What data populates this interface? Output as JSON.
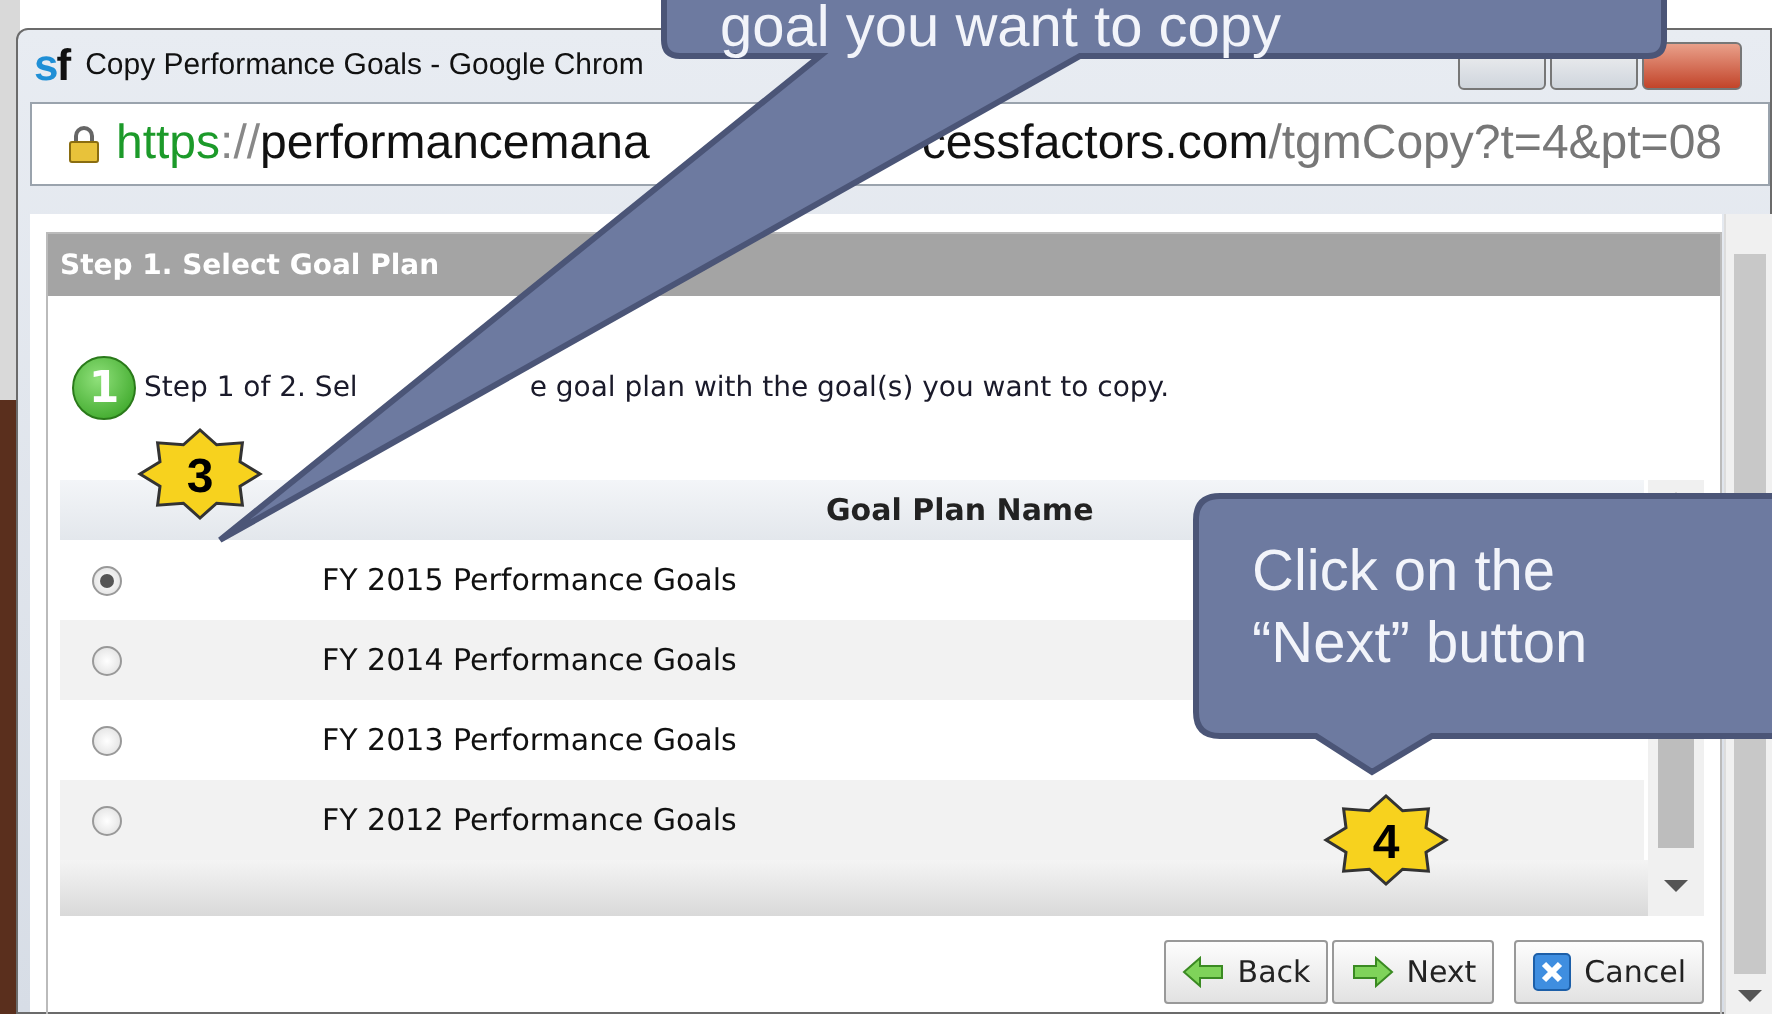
{
  "window": {
    "logo": "sf",
    "title": "Copy Performance Goals - Google Chrom"
  },
  "address_bar": {
    "url_parts": [
      {
        "text": "https",
        "kind": "scheme"
      },
      {
        "text": "://",
        "kind": "sep"
      },
      {
        "text": "performancemana",
        "kind": "host"
      },
      {
        "text": "cessfactors.com",
        "kind": "host"
      },
      {
        "text": "/tgmCopy?t=4&pt=08",
        "kind": "path"
      }
    ]
  },
  "panel": {
    "title": "Step 1. Select Goal Plan",
    "step_number": "1",
    "instruction_parts": [
      "Step 1 of 2. Sel",
      "e goal plan with the goal(s) you want to copy."
    ]
  },
  "table": {
    "columns": [
      "Goal Plan Name"
    ],
    "rows": [
      {
        "name": "FY 2015 Performance Goals",
        "selected": true
      },
      {
        "name": "FY 2014 Performance Goals",
        "selected": false
      },
      {
        "name": "FY 2013 Performance Goals",
        "selected": false
      },
      {
        "name": "FY 2012 Performance Goals",
        "selected": false
      }
    ]
  },
  "buttons": [
    {
      "label": "Back",
      "kind": "back"
    },
    {
      "label": "Next",
      "kind": "next"
    },
    {
      "label": "Cancel",
      "kind": "cancel"
    }
  ],
  "callouts": [
    {
      "text": "goal you want to copy",
      "kind": "top"
    },
    {
      "text": "Click on the “Next” button",
      "kind": "side"
    }
  ],
  "step_badges": [
    {
      "label": "3",
      "kind": "radio"
    },
    {
      "label": "4",
      "kind": "button"
    }
  ]
}
